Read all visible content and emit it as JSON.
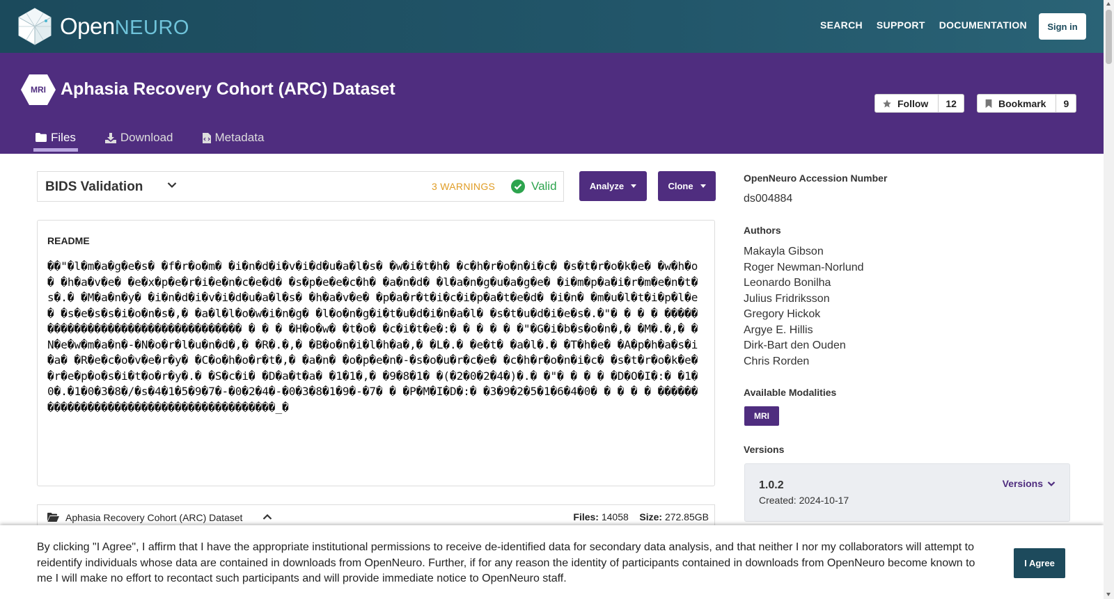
{
  "nav": {
    "brand_main": "Open",
    "brand_accent": "NEURO",
    "links": [
      "SEARCH",
      "SUPPORT",
      "DOCUMENTATION"
    ],
    "signin_label": "Sign in"
  },
  "dataset": {
    "modality_badge": "MRI",
    "title": "Aphasia Recovery Cohort (ARC) Dataset",
    "follow_label": "Follow",
    "follow_count": "12",
    "bookmark_label": "Bookmark",
    "bookmark_count": "9",
    "tabs": [
      {
        "label": "Files",
        "icon": "folder-icon",
        "active": true
      },
      {
        "label": "Download",
        "icon": "download-icon",
        "active": false
      },
      {
        "label": "Metadata",
        "icon": "file-code-icon",
        "active": false
      }
    ]
  },
  "validation": {
    "title": "BIDS Validation",
    "warnings": "3 WARNINGS",
    "status": "Valid",
    "status_color": "#2da44e",
    "warn_color": "#e09d26"
  },
  "actions": {
    "analyze_label": "Analyze",
    "clone_label": "Clone"
  },
  "readme": {
    "heading": "README",
    "body": "��\"�l�m�a�g�e�s� �f�r�o�m� �i�n�d�i�v�i�d�u�a�l�s� �w�i�t�h� �c�h�r�o�n�i�c� �s�t�r�o�k�e� �w�h�o� �h�a�v�e� �e�x�p�e�r�i�e�n�c�e�d� �s�p�e�e�c�h� �a�n�d� �l�a�n�g�u�a�g�e� �i�m�p�a�i�r�m�e�n�t�s�.� �M�a�n�y� �i�n�d�i�v�i�d�u�a�l�s� �h�a�v�e� �p�a�r�t�i�c�i�p�a�t�e�d� �i�n� �m�u�l�t�i�p�l�e� �s�e�s�s�i�o�n�s�,� �a�l�l�o�w�i�n�g� �l�o�n�g�i�t�u�d�i�n�a�l� �s�t�u�d�i�e�s�.�\"� � � � ���������������������������������� � � � �H�o�w� �t�o� �c�i�t�e�:� � � � � �\"�G�i�b�s�o�n�,� �M�.�,� �N�e�w�m�a�n�-�N�o�r�l�u�n�d�,� �R�.�,� �B�o�n�i�l�h�a�,� �L�.� �e�t� �a�l�.� �T�h�e� �A�p�h�a�s�i�a� �R�e�c�o�v�e�r�y� �C�o�h�o�r�t�,� �a�n� �o�p�e�n�-�s�o�u�r�c�e� �c�h�r�o�n�i�c� �s�t�r�o�k�e� �r�e�p�o�s�i�t�o�r�y�.� �S�c�i� �D�a�t�a� �1�1�,� �9�8�1� �(�2�0�2�4�)�.� �\"� � � � �D�O�I�:� �1�0�.�1�0�3�8�/�s�4�1�5�9�7�-�0�2�4�-�0�3�8�1�9�-�7� � �P�M�I�D�:� �3�9�2�5�1�6�4�0� � � � � ����������������������������������������_�"
  },
  "filebar": {
    "name": "Aphasia Recovery Cohort (ARC) Dataset",
    "files_label": "Files:",
    "files_value": "14058",
    "size_label": "Size:",
    "size_value": "272.85GB"
  },
  "sidebar": {
    "accession_heading": "OpenNeuro Accession Number",
    "accession": "ds004884",
    "authors_heading": "Authors",
    "authors": [
      "Makayla Gibson",
      "Roger Newman-Norlund",
      "Leonardo Bonilha",
      "Julius Fridriksson",
      "Gregory Hickok",
      "Argye E. Hillis",
      "Dirk-Bart den Ouden",
      "Chris Rorden"
    ],
    "modalities_heading": "Available Modalities",
    "modality": "MRI",
    "versions_heading": "Versions",
    "version": "1.0.2",
    "created": "Created: 2024-10-17",
    "versions_link": "Versions"
  },
  "consent": {
    "text": "By clicking \"I Agree\", I affirm that I have the appropriate institutional permissions to receive de-identified data for secondary data analysis, and that neither I nor my collaborators will attempt to reidentify individuals whose data are contained in downloads from OpenNeuro. Further, if for any reason the identity of participants contained in downloads from OpenNeuro become known to me I will make no effort to recontact such participants and will provide immediate notice to OpenNeuro staff.",
    "agree_label": "I Agree"
  },
  "colors": {
    "nav_bg": "#1b4a5c",
    "header_bg": "#4f2d7f",
    "accent_teal": "#6fc3da"
  }
}
